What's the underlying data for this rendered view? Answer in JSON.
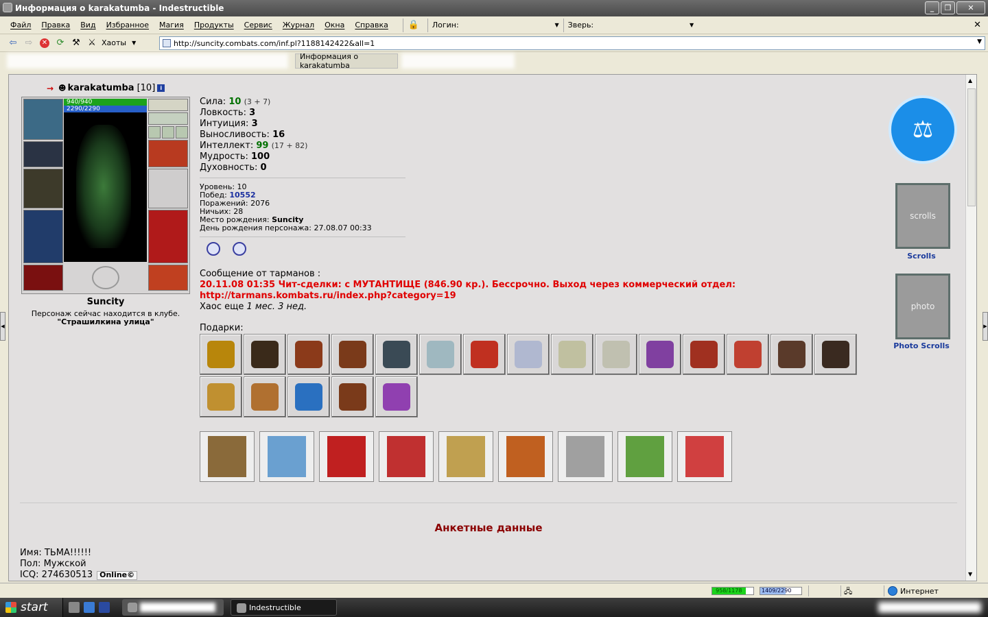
{
  "window": {
    "title": "Информация о karakatumba - Indestructible"
  },
  "menu": {
    "items": [
      "Файл",
      "Правка",
      "Вид",
      "Избранное",
      "Магия",
      "Продукты",
      "Сервис",
      "Журнал",
      "Окна",
      "Справка"
    ],
    "login_label": "Логин:",
    "beast_label": "Зверь:"
  },
  "nav": {
    "mode_label": "Хаоты",
    "url": "http://suncity.combats.com/inf.pl?1188142422&all=1"
  },
  "tabs": {
    "active_label": "Информация о karakatumba"
  },
  "character": {
    "name": "karakatumba",
    "level": "[10]",
    "hp": "940/940",
    "mana": "2290/2290",
    "city": "Suncity",
    "location_note": "Персонаж сейчас находится в клубе.",
    "location_name": "\"Страшилкина улица\""
  },
  "stats": [
    {
      "label": "Сила:",
      "value": "10",
      "extra": "(3 + 7)",
      "green": true
    },
    {
      "label": "Ловкость:",
      "value": "3",
      "extra": "",
      "green": false
    },
    {
      "label": "Интуиция:",
      "value": "3",
      "extra": "",
      "green": false
    },
    {
      "label": "Выносливость:",
      "value": "16",
      "extra": "",
      "green": false
    },
    {
      "label": "Интеллект:",
      "value": "99",
      "extra": "(17 + 82)",
      "green": true
    },
    {
      "label": "Мудрость:",
      "value": "100",
      "extra": "",
      "green": false
    },
    {
      "label": "Духовность:",
      "value": "0",
      "extra": "",
      "green": false
    }
  ],
  "info": {
    "level_label": "Уровень:",
    "level": "10",
    "wins_label": "Побед:",
    "wins": "10552",
    "losses_label": "Поражений:",
    "losses": "2076",
    "draws_label": "Ничьих:",
    "draws": "28",
    "birthplace_label": "Место рождения:",
    "birthplace": "Suncity",
    "birthday_label": "День рождения персонажа:",
    "birthday": "27.08.07 00:33"
  },
  "message": {
    "header": "Сообщение от тарманов :",
    "line1": "20.11.08 01:35 Чит-сделки: с МУТАНТИЩЕ (846.90 кр.). Бессрочно. Выход через коммерческий отдел:",
    "line2": "http://tarmans.kombats.ru/index.php?category=19",
    "chaos_prefix": "Хаос еще ",
    "chaos_time": "1 мес. 3 нед."
  },
  "gifts": {
    "label": "Подарки:",
    "colors": [
      "#b8860b",
      "#3a2a1a",
      "#8b3a1a",
      "#7a3a1a",
      "#3a4a55",
      "#9fb8c0",
      "#c03020",
      "#b0b8d0",
      "#c0c0a0",
      "#c0c0b0",
      "#8040a0",
      "#a03020",
      "#c04030",
      "#5a3a2a",
      "#3a2a20",
      "#c09030",
      "#b07030",
      "#2a70c0",
      "#7a3a1a",
      "#9040b0"
    ]
  },
  "cards": {
    "colors": [
      "#8a6a3a",
      "#6aa0d0",
      "#c02020",
      "#c03030",
      "#c0a050",
      "#c06020",
      "#a0a0a0",
      "#60a040",
      "#d04040"
    ]
  },
  "right": {
    "scrolls_label": "Scrolls",
    "scrolls_icon_text": "scrolls",
    "photo_label": "Photo Scrolls",
    "photo_icon_text": "photo"
  },
  "profile": {
    "section_title": "Анкетные данные",
    "name_label": "Имя:",
    "name": "ТЬМА!!!!!!",
    "sex_label": "Пол:",
    "sex": "Мужской",
    "icq_label": "ICQ:",
    "icq": "274630513",
    "online_label": "Online"
  },
  "statusbar": {
    "hp_text": "958/1178",
    "hp_fraction": 0.81,
    "mana_text": "1409/2290",
    "mana_fraction": 0.61,
    "zone": "Интернет"
  },
  "taskbar": {
    "start_label": "start",
    "active_window": "Indestructible"
  }
}
